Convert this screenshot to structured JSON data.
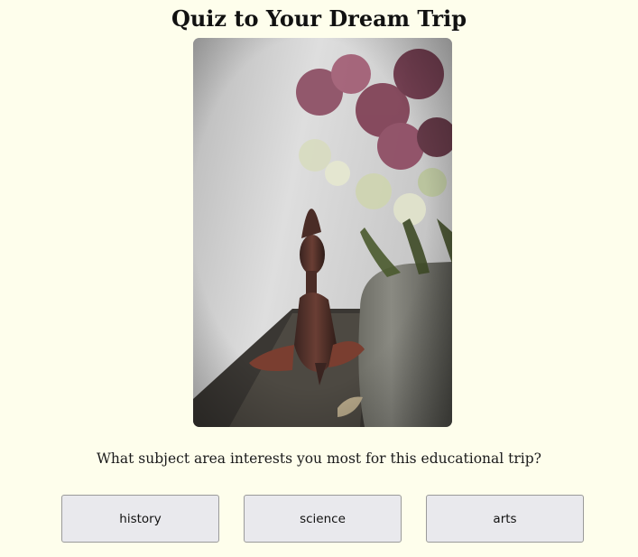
{
  "page": {
    "title": "Quiz to Your Dream Trip"
  },
  "quiz": {
    "question": "What subject area interests you most for this educational trip?",
    "answers": [
      {
        "label": "history"
      },
      {
        "label": "science"
      },
      {
        "label": "arts"
      }
    ]
  },
  "colors": {
    "background": "#fefeec",
    "button_bg": "#e9e9ed",
    "button_border": "#9a9a9a"
  }
}
